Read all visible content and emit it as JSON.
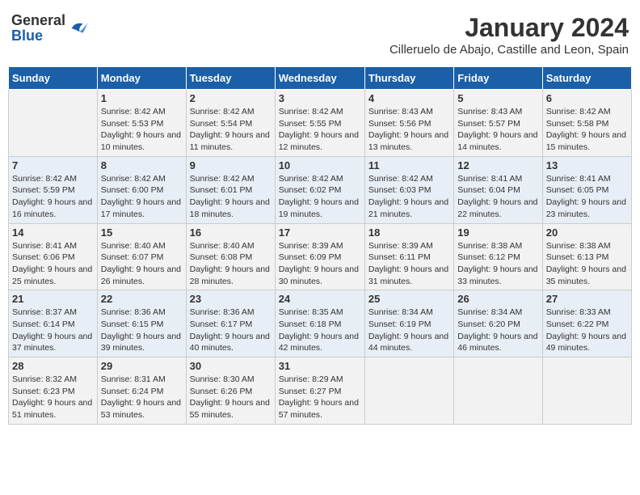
{
  "logo": {
    "general": "General",
    "blue": "Blue"
  },
  "header": {
    "month": "January 2024",
    "location": "Cilleruelo de Abajo, Castille and Leon, Spain"
  },
  "days_of_week": [
    "Sunday",
    "Monday",
    "Tuesday",
    "Wednesday",
    "Thursday",
    "Friday",
    "Saturday"
  ],
  "weeks": [
    [
      {
        "day": "",
        "sunrise": "",
        "sunset": "",
        "daylight": ""
      },
      {
        "day": "1",
        "sunrise": "Sunrise: 8:42 AM",
        "sunset": "Sunset: 5:53 PM",
        "daylight": "Daylight: 9 hours and 10 minutes."
      },
      {
        "day": "2",
        "sunrise": "Sunrise: 8:42 AM",
        "sunset": "Sunset: 5:54 PM",
        "daylight": "Daylight: 9 hours and 11 minutes."
      },
      {
        "day": "3",
        "sunrise": "Sunrise: 8:42 AM",
        "sunset": "Sunset: 5:55 PM",
        "daylight": "Daylight: 9 hours and 12 minutes."
      },
      {
        "day": "4",
        "sunrise": "Sunrise: 8:43 AM",
        "sunset": "Sunset: 5:56 PM",
        "daylight": "Daylight: 9 hours and 13 minutes."
      },
      {
        "day": "5",
        "sunrise": "Sunrise: 8:43 AM",
        "sunset": "Sunset: 5:57 PM",
        "daylight": "Daylight: 9 hours and 14 minutes."
      },
      {
        "day": "6",
        "sunrise": "Sunrise: 8:42 AM",
        "sunset": "Sunset: 5:58 PM",
        "daylight": "Daylight: 9 hours and 15 minutes."
      }
    ],
    [
      {
        "day": "7",
        "sunrise": "Sunrise: 8:42 AM",
        "sunset": "Sunset: 5:59 PM",
        "daylight": "Daylight: 9 hours and 16 minutes."
      },
      {
        "day": "8",
        "sunrise": "Sunrise: 8:42 AM",
        "sunset": "Sunset: 6:00 PM",
        "daylight": "Daylight: 9 hours and 17 minutes."
      },
      {
        "day": "9",
        "sunrise": "Sunrise: 8:42 AM",
        "sunset": "Sunset: 6:01 PM",
        "daylight": "Daylight: 9 hours and 18 minutes."
      },
      {
        "day": "10",
        "sunrise": "Sunrise: 8:42 AM",
        "sunset": "Sunset: 6:02 PM",
        "daylight": "Daylight: 9 hours and 19 minutes."
      },
      {
        "day": "11",
        "sunrise": "Sunrise: 8:42 AM",
        "sunset": "Sunset: 6:03 PM",
        "daylight": "Daylight: 9 hours and 21 minutes."
      },
      {
        "day": "12",
        "sunrise": "Sunrise: 8:41 AM",
        "sunset": "Sunset: 6:04 PM",
        "daylight": "Daylight: 9 hours and 22 minutes."
      },
      {
        "day": "13",
        "sunrise": "Sunrise: 8:41 AM",
        "sunset": "Sunset: 6:05 PM",
        "daylight": "Daylight: 9 hours and 23 minutes."
      }
    ],
    [
      {
        "day": "14",
        "sunrise": "Sunrise: 8:41 AM",
        "sunset": "Sunset: 6:06 PM",
        "daylight": "Daylight: 9 hours and 25 minutes."
      },
      {
        "day": "15",
        "sunrise": "Sunrise: 8:40 AM",
        "sunset": "Sunset: 6:07 PM",
        "daylight": "Daylight: 9 hours and 26 minutes."
      },
      {
        "day": "16",
        "sunrise": "Sunrise: 8:40 AM",
        "sunset": "Sunset: 6:08 PM",
        "daylight": "Daylight: 9 hours and 28 minutes."
      },
      {
        "day": "17",
        "sunrise": "Sunrise: 8:39 AM",
        "sunset": "Sunset: 6:09 PM",
        "daylight": "Daylight: 9 hours and 30 minutes."
      },
      {
        "day": "18",
        "sunrise": "Sunrise: 8:39 AM",
        "sunset": "Sunset: 6:11 PM",
        "daylight": "Daylight: 9 hours and 31 minutes."
      },
      {
        "day": "19",
        "sunrise": "Sunrise: 8:38 AM",
        "sunset": "Sunset: 6:12 PM",
        "daylight": "Daylight: 9 hours and 33 minutes."
      },
      {
        "day": "20",
        "sunrise": "Sunrise: 8:38 AM",
        "sunset": "Sunset: 6:13 PM",
        "daylight": "Daylight: 9 hours and 35 minutes."
      }
    ],
    [
      {
        "day": "21",
        "sunrise": "Sunrise: 8:37 AM",
        "sunset": "Sunset: 6:14 PM",
        "daylight": "Daylight: 9 hours and 37 minutes."
      },
      {
        "day": "22",
        "sunrise": "Sunrise: 8:36 AM",
        "sunset": "Sunset: 6:15 PM",
        "daylight": "Daylight: 9 hours and 39 minutes."
      },
      {
        "day": "23",
        "sunrise": "Sunrise: 8:36 AM",
        "sunset": "Sunset: 6:17 PM",
        "daylight": "Daylight: 9 hours and 40 minutes."
      },
      {
        "day": "24",
        "sunrise": "Sunrise: 8:35 AM",
        "sunset": "Sunset: 6:18 PM",
        "daylight": "Daylight: 9 hours and 42 minutes."
      },
      {
        "day": "25",
        "sunrise": "Sunrise: 8:34 AM",
        "sunset": "Sunset: 6:19 PM",
        "daylight": "Daylight: 9 hours and 44 minutes."
      },
      {
        "day": "26",
        "sunrise": "Sunrise: 8:34 AM",
        "sunset": "Sunset: 6:20 PM",
        "daylight": "Daylight: 9 hours and 46 minutes."
      },
      {
        "day": "27",
        "sunrise": "Sunrise: 8:33 AM",
        "sunset": "Sunset: 6:22 PM",
        "daylight": "Daylight: 9 hours and 49 minutes."
      }
    ],
    [
      {
        "day": "28",
        "sunrise": "Sunrise: 8:32 AM",
        "sunset": "Sunset: 6:23 PM",
        "daylight": "Daylight: 9 hours and 51 minutes."
      },
      {
        "day": "29",
        "sunrise": "Sunrise: 8:31 AM",
        "sunset": "Sunset: 6:24 PM",
        "daylight": "Daylight: 9 hours and 53 minutes."
      },
      {
        "day": "30",
        "sunrise": "Sunrise: 8:30 AM",
        "sunset": "Sunset: 6:26 PM",
        "daylight": "Daylight: 9 hours and 55 minutes."
      },
      {
        "day": "31",
        "sunrise": "Sunrise: 8:29 AM",
        "sunset": "Sunset: 6:27 PM",
        "daylight": "Daylight: 9 hours and 57 minutes."
      },
      {
        "day": "",
        "sunrise": "",
        "sunset": "",
        "daylight": ""
      },
      {
        "day": "",
        "sunrise": "",
        "sunset": "",
        "daylight": ""
      },
      {
        "day": "",
        "sunrise": "",
        "sunset": "",
        "daylight": ""
      }
    ]
  ]
}
